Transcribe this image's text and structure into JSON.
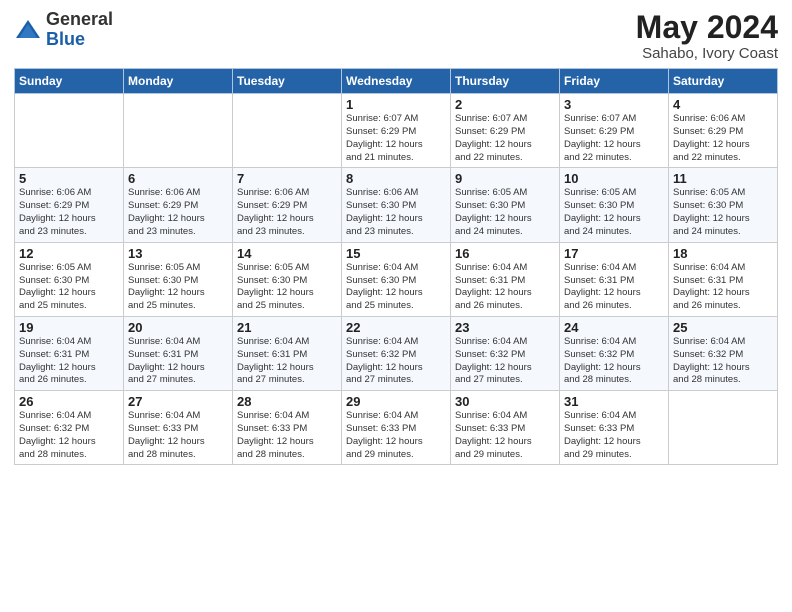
{
  "header": {
    "logo_general": "General",
    "logo_blue": "Blue",
    "month_title": "May 2024",
    "location": "Sahabo, Ivory Coast"
  },
  "weekdays": [
    "Sunday",
    "Monday",
    "Tuesday",
    "Wednesday",
    "Thursday",
    "Friday",
    "Saturday"
  ],
  "weeks": [
    [
      {
        "day": "",
        "info": ""
      },
      {
        "day": "",
        "info": ""
      },
      {
        "day": "",
        "info": ""
      },
      {
        "day": "1",
        "info": "Sunrise: 6:07 AM\nSunset: 6:29 PM\nDaylight: 12 hours\nand 21 minutes."
      },
      {
        "day": "2",
        "info": "Sunrise: 6:07 AM\nSunset: 6:29 PM\nDaylight: 12 hours\nand 22 minutes."
      },
      {
        "day": "3",
        "info": "Sunrise: 6:07 AM\nSunset: 6:29 PM\nDaylight: 12 hours\nand 22 minutes."
      },
      {
        "day": "4",
        "info": "Sunrise: 6:06 AM\nSunset: 6:29 PM\nDaylight: 12 hours\nand 22 minutes."
      }
    ],
    [
      {
        "day": "5",
        "info": "Sunrise: 6:06 AM\nSunset: 6:29 PM\nDaylight: 12 hours\nand 23 minutes."
      },
      {
        "day": "6",
        "info": "Sunrise: 6:06 AM\nSunset: 6:29 PM\nDaylight: 12 hours\nand 23 minutes."
      },
      {
        "day": "7",
        "info": "Sunrise: 6:06 AM\nSunset: 6:29 PM\nDaylight: 12 hours\nand 23 minutes."
      },
      {
        "day": "8",
        "info": "Sunrise: 6:06 AM\nSunset: 6:30 PM\nDaylight: 12 hours\nand 23 minutes."
      },
      {
        "day": "9",
        "info": "Sunrise: 6:05 AM\nSunset: 6:30 PM\nDaylight: 12 hours\nand 24 minutes."
      },
      {
        "day": "10",
        "info": "Sunrise: 6:05 AM\nSunset: 6:30 PM\nDaylight: 12 hours\nand 24 minutes."
      },
      {
        "day": "11",
        "info": "Sunrise: 6:05 AM\nSunset: 6:30 PM\nDaylight: 12 hours\nand 24 minutes."
      }
    ],
    [
      {
        "day": "12",
        "info": "Sunrise: 6:05 AM\nSunset: 6:30 PM\nDaylight: 12 hours\nand 25 minutes."
      },
      {
        "day": "13",
        "info": "Sunrise: 6:05 AM\nSunset: 6:30 PM\nDaylight: 12 hours\nand 25 minutes."
      },
      {
        "day": "14",
        "info": "Sunrise: 6:05 AM\nSunset: 6:30 PM\nDaylight: 12 hours\nand 25 minutes."
      },
      {
        "day": "15",
        "info": "Sunrise: 6:04 AM\nSunset: 6:30 PM\nDaylight: 12 hours\nand 25 minutes."
      },
      {
        "day": "16",
        "info": "Sunrise: 6:04 AM\nSunset: 6:31 PM\nDaylight: 12 hours\nand 26 minutes."
      },
      {
        "day": "17",
        "info": "Sunrise: 6:04 AM\nSunset: 6:31 PM\nDaylight: 12 hours\nand 26 minutes."
      },
      {
        "day": "18",
        "info": "Sunrise: 6:04 AM\nSunset: 6:31 PM\nDaylight: 12 hours\nand 26 minutes."
      }
    ],
    [
      {
        "day": "19",
        "info": "Sunrise: 6:04 AM\nSunset: 6:31 PM\nDaylight: 12 hours\nand 26 minutes."
      },
      {
        "day": "20",
        "info": "Sunrise: 6:04 AM\nSunset: 6:31 PM\nDaylight: 12 hours\nand 27 minutes."
      },
      {
        "day": "21",
        "info": "Sunrise: 6:04 AM\nSunset: 6:31 PM\nDaylight: 12 hours\nand 27 minutes."
      },
      {
        "day": "22",
        "info": "Sunrise: 6:04 AM\nSunset: 6:32 PM\nDaylight: 12 hours\nand 27 minutes."
      },
      {
        "day": "23",
        "info": "Sunrise: 6:04 AM\nSunset: 6:32 PM\nDaylight: 12 hours\nand 27 minutes."
      },
      {
        "day": "24",
        "info": "Sunrise: 6:04 AM\nSunset: 6:32 PM\nDaylight: 12 hours\nand 28 minutes."
      },
      {
        "day": "25",
        "info": "Sunrise: 6:04 AM\nSunset: 6:32 PM\nDaylight: 12 hours\nand 28 minutes."
      }
    ],
    [
      {
        "day": "26",
        "info": "Sunrise: 6:04 AM\nSunset: 6:32 PM\nDaylight: 12 hours\nand 28 minutes."
      },
      {
        "day": "27",
        "info": "Sunrise: 6:04 AM\nSunset: 6:33 PM\nDaylight: 12 hours\nand 28 minutes."
      },
      {
        "day": "28",
        "info": "Sunrise: 6:04 AM\nSunset: 6:33 PM\nDaylight: 12 hours\nand 28 minutes."
      },
      {
        "day": "29",
        "info": "Sunrise: 6:04 AM\nSunset: 6:33 PM\nDaylight: 12 hours\nand 29 minutes."
      },
      {
        "day": "30",
        "info": "Sunrise: 6:04 AM\nSunset: 6:33 PM\nDaylight: 12 hours\nand 29 minutes."
      },
      {
        "day": "31",
        "info": "Sunrise: 6:04 AM\nSunset: 6:33 PM\nDaylight: 12 hours\nand 29 minutes."
      },
      {
        "day": "",
        "info": ""
      }
    ]
  ]
}
